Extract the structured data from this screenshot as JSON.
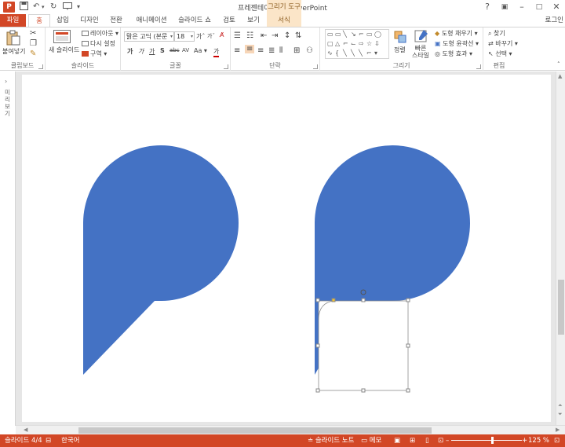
{
  "window": {
    "title": "프레젠테이션1 - PowerPoint",
    "context_tab_group": "그리기 도구",
    "login": "로그인"
  },
  "quick_access": {
    "app_icon": "P",
    "save_icon": "save-icon",
    "undo_icon": "undo-icon",
    "redo_icon": "redo-icon"
  },
  "tabs": [
    {
      "id": "file",
      "label": "파일"
    },
    {
      "id": "home",
      "label": "홈"
    },
    {
      "id": "insert",
      "label": "삽입"
    },
    {
      "id": "design",
      "label": "디자인"
    },
    {
      "id": "transitions",
      "label": "전환"
    },
    {
      "id": "animations",
      "label": "애니메이션"
    },
    {
      "id": "slideshow",
      "label": "슬라이드 쇼"
    },
    {
      "id": "review",
      "label": "검토"
    },
    {
      "id": "view",
      "label": "보기"
    },
    {
      "id": "format",
      "label": "서식"
    }
  ],
  "ribbon": {
    "clipboard": {
      "label": "클립보드",
      "paste": "붙여넣기"
    },
    "slides": {
      "label": "슬라이드",
      "new_slide": "새 슬라이드",
      "layout": "레이아웃",
      "reset": "다시 설정",
      "section": "구역"
    },
    "font": {
      "label": "글꼴",
      "font_name": "맑은 고딕 (본문",
      "font_size": "18",
      "bold": "가",
      "italic": "가",
      "underline": "가",
      "shadow": "S",
      "strike": "abc",
      "spacing": "AV",
      "case": "Aa",
      "color": "가"
    },
    "paragraph": {
      "label": "단락"
    },
    "drawing": {
      "label": "그리기",
      "arrange": "정렬",
      "quick_styles": "빠른 스타일",
      "shape_fill": "도형 채우기",
      "shape_outline": "도형 윤곽선",
      "shape_effects": "도형 효과"
    },
    "editing": {
      "label": "편집",
      "find": "찾기",
      "replace": "바꾸기",
      "select": "선택"
    }
  },
  "thumbnail_pane": {
    "label": "미리 보기"
  },
  "status": {
    "slide_info": "슬라이드 4/4",
    "language": "한국어",
    "notes": "슬라이드 노트",
    "comments": "메모",
    "zoom": "125 %"
  },
  "colors": {
    "accent": "#d24726",
    "shape_fill": "#4472c4"
  }
}
